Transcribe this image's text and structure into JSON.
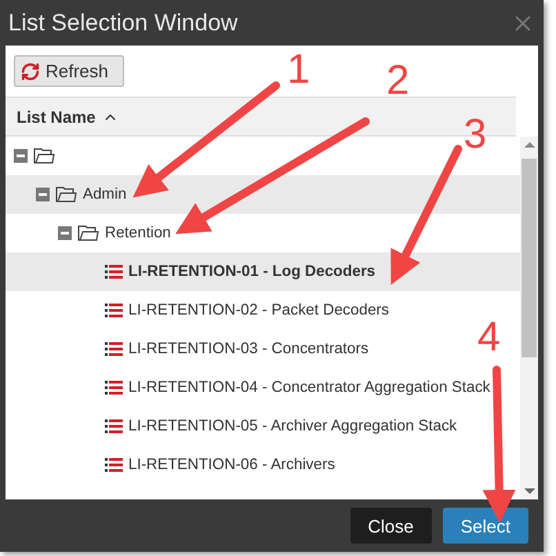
{
  "window": {
    "title": "List Selection Window"
  },
  "toolbar": {
    "refresh_button": "Refresh"
  },
  "table": {
    "column": {
      "label": "List Name",
      "sorted_ascending": true
    },
    "tree": [
      {
        "kind": "folder",
        "expanded": true,
        "children": [
          {
            "kind": "folder",
            "label": "Admin",
            "expanded": true,
            "hovered": true,
            "selected": false,
            "children": [
              {
                "kind": "folder",
                "label": "Retention",
                "expanded": true,
                "hovered": false,
                "selected": false,
                "children": [
                  {
                    "kind": "list",
                    "label": "LI-RETENTION-01 - Log Decoders",
                    "hovered": false,
                    "selected": true
                  },
                  {
                    "kind": "list",
                    "label": "LI-RETENTION-02 - Packet Decoders",
                    "hovered": false,
                    "selected": false
                  },
                  {
                    "kind": "list",
                    "label": "LI-RETENTION-03 - Concentrators",
                    "hovered": false,
                    "selected": false
                  },
                  {
                    "kind": "list",
                    "label": "LI-RETENTION-04 - Concentrator Aggregation Stack",
                    "hovered": false,
                    "selected": false
                  },
                  {
                    "kind": "list",
                    "label": "LI-RETENTION-05 - Archiver Aggregation Stack",
                    "hovered": false,
                    "selected": false
                  },
                  {
                    "kind": "list",
                    "label": "LI-RETENTION-06 - Archivers",
                    "hovered": false,
                    "selected": false
                  }
                ]
              }
            ]
          }
        ]
      }
    ]
  },
  "buttons": [
    {
      "label": "Close",
      "kind": "secondary"
    },
    {
      "label": "Select",
      "kind": "primary"
    }
  ],
  "annotations": [
    {
      "label": "1"
    },
    {
      "label": "2"
    },
    {
      "label": "3"
    },
    {
      "label": "4"
    }
  ]
}
